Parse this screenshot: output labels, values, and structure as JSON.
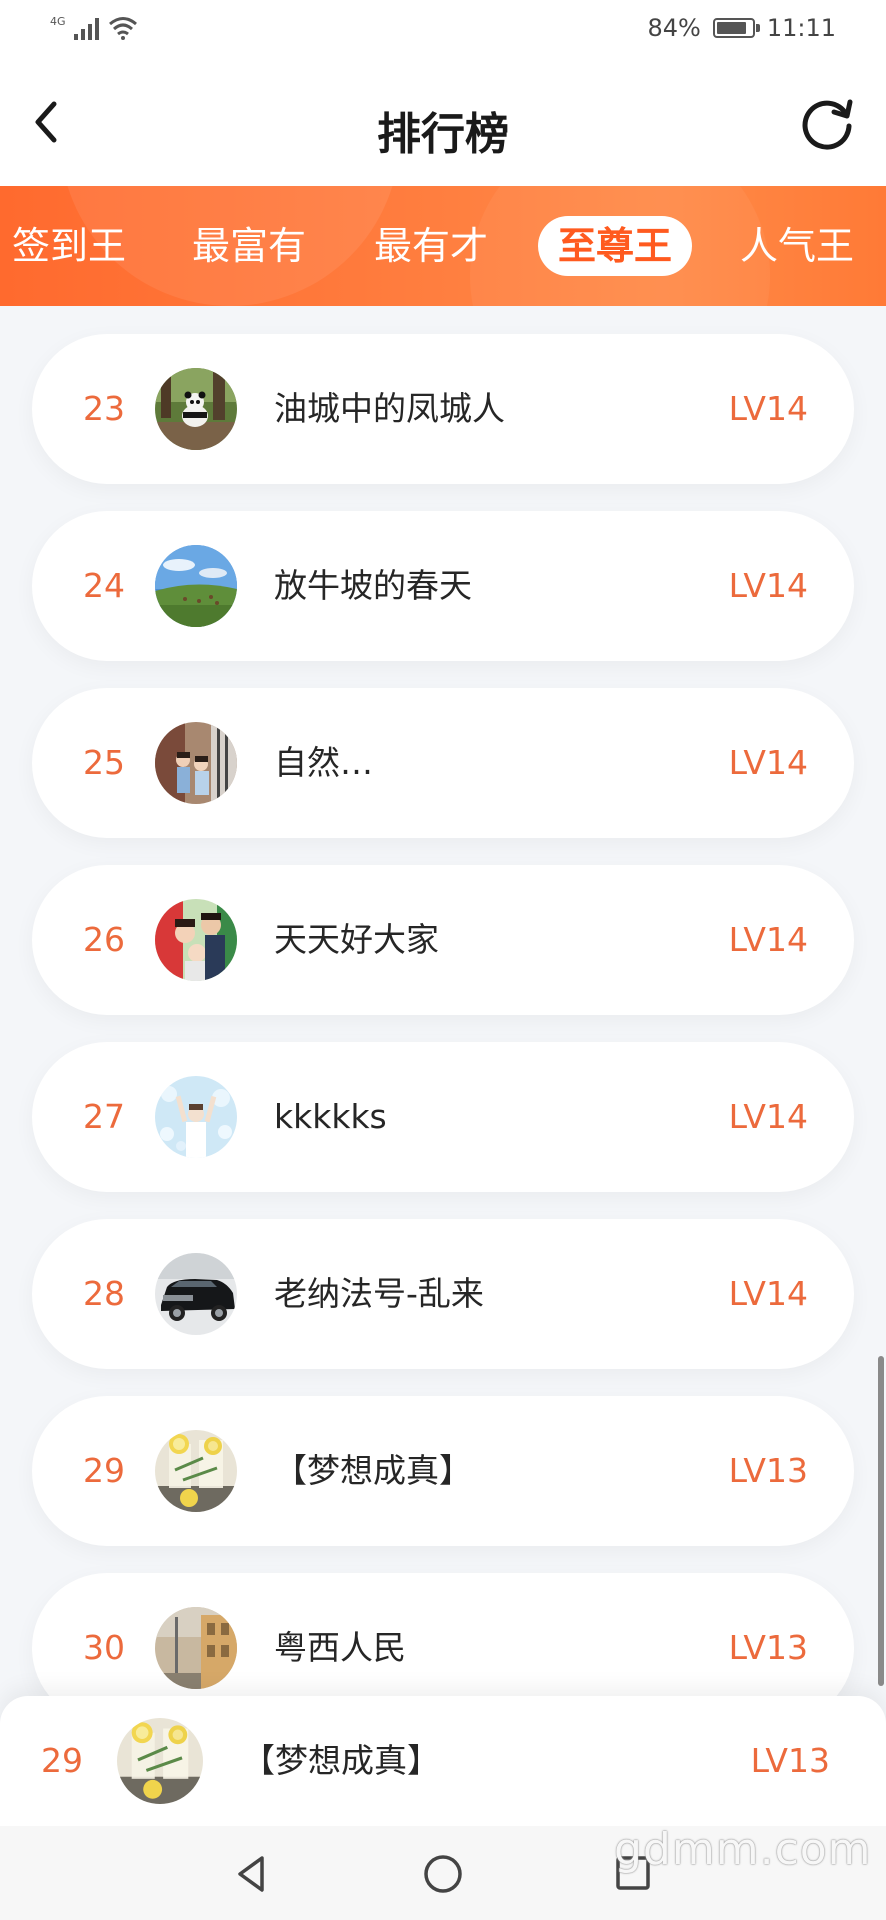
{
  "status_bar": {
    "network": "4G",
    "battery": "84%",
    "battery_level": 0.84,
    "time": "11:11"
  },
  "nav": {
    "title": "排行榜",
    "back_icon": "chevron-left-icon",
    "refresh_icon": "refresh-icon"
  },
  "tabs": [
    {
      "label": "签到王",
      "active": false
    },
    {
      "label": "最富有",
      "active": false
    },
    {
      "label": "最有才",
      "active": false
    },
    {
      "label": "至尊王",
      "active": true
    },
    {
      "label": "人气王",
      "active": false
    }
  ],
  "accent_color": "#ff6a2e",
  "rank_color": "#ec6a3c",
  "ranking": [
    {
      "rank": "23",
      "name": "油城中的凤城人",
      "level": "LV14",
      "avatar": "panda-photo"
    },
    {
      "rank": "24",
      "name": "放牛坡的春天",
      "level": "LV14",
      "avatar": "meadow-photo"
    },
    {
      "rank": "25",
      "name": "自然…",
      "level": "LV14",
      "avatar": "women-photo"
    },
    {
      "rank": "26",
      "name": "天天好大家",
      "level": "LV14",
      "avatar": "family-photo"
    },
    {
      "rank": "27",
      "name": "kkkkks",
      "level": "LV14",
      "avatar": "bubbles-photo"
    },
    {
      "rank": "28",
      "name": "老纳法号-乱来",
      "level": "LV14",
      "avatar": "car-photo"
    },
    {
      "rank": "29",
      "name": "【梦想成真】",
      "level": "LV13",
      "avatar": "lemon-drink-photo"
    },
    {
      "rank": "30",
      "name": "粤西人民",
      "level": "LV13",
      "avatar": "street-photo"
    }
  ],
  "my_rank": {
    "rank": "29",
    "name": "【梦想成真】",
    "level": "LV13",
    "avatar": "lemon-drink-photo"
  },
  "system_nav": {
    "back": "triangle-back-icon",
    "home": "circle-home-icon",
    "recent": "square-recent-icon"
  },
  "watermark": "gdmm.com"
}
